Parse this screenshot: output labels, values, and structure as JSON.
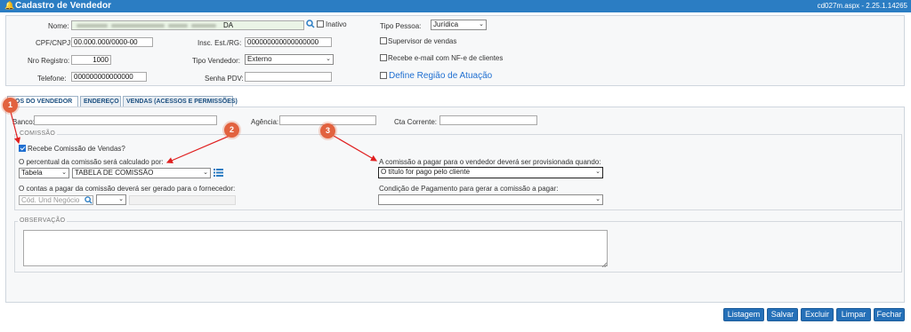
{
  "window": {
    "title": "Cadastro de Vendedor",
    "version": "cd027m.aspx - 2.25.1.14265"
  },
  "header_form": {
    "nome_label": "Nome:",
    "nome_value_suffix": "DA",
    "inativo_label": "Inativo",
    "tipo_pessoa_label": "Tipo Pessoa:",
    "tipo_pessoa_value": "Jurídica",
    "cpf_label": "CPF/CNPJ:",
    "cpf_value": "00.000.000/0000-00",
    "insc_label": "Insc. Est./RG:",
    "insc_value": "000000000000000000",
    "supervisor_label": "Supervisor de vendas",
    "nro_registro_label": "Nro Registro:",
    "nro_registro_value": "1000",
    "tipo_vendedor_label": "Tipo Vendedor:",
    "tipo_vendedor_value": "Externo",
    "recebe_email_label": "Recebe e-mail com NF-e de clientes",
    "telefone_label": "Telefone:",
    "telefone_value": "000000000000000",
    "senha_pdv_label": "Senha PDV:",
    "define_regiao_label": "Define Região de Atuação"
  },
  "tabs": [
    {
      "label": "dos do Vendedor"
    },
    {
      "label": "Endereço"
    },
    {
      "label": "Vendas (Acessos e Permissões)"
    }
  ],
  "bank": {
    "banco_label": "Banco:",
    "agencia_label": "Agência:",
    "cta_corrente_label": "Cta Corrente:"
  },
  "comissao": {
    "legend": "Comissão",
    "recebe_label": "Recebe Comissão de Vendas?",
    "percentual_label": "O percentual da comissão será calculado por:",
    "tipo_value": "Tabela",
    "tabela_value": "TABELA DE COMISSÃO",
    "contas_label": "O contas a pagar da comissão deverá ser gerado para o fornecedor:",
    "cod_placeholder": "Cód. Und Negócio",
    "provisionada_label": "A comissão a pagar para o vendedor deverá ser provisionada quando:",
    "provisionada_value": "O título for pago pelo cliente",
    "condicao_label": "Condição de Pagamento para gerar a comissão a pagar:"
  },
  "observacao": {
    "legend": "Observação"
  },
  "buttons": {
    "listagem": "Listagem",
    "salvar": "Salvar",
    "excluir": "Excluir",
    "limpar": "Limpar",
    "fechar": "Fechar"
  },
  "markers": [
    "1",
    "2",
    "3"
  ],
  "colors": {
    "titlebar": "#2b7dc3",
    "button": "#2570b8",
    "marker": "#e2623f",
    "arrow": "#e02020"
  }
}
